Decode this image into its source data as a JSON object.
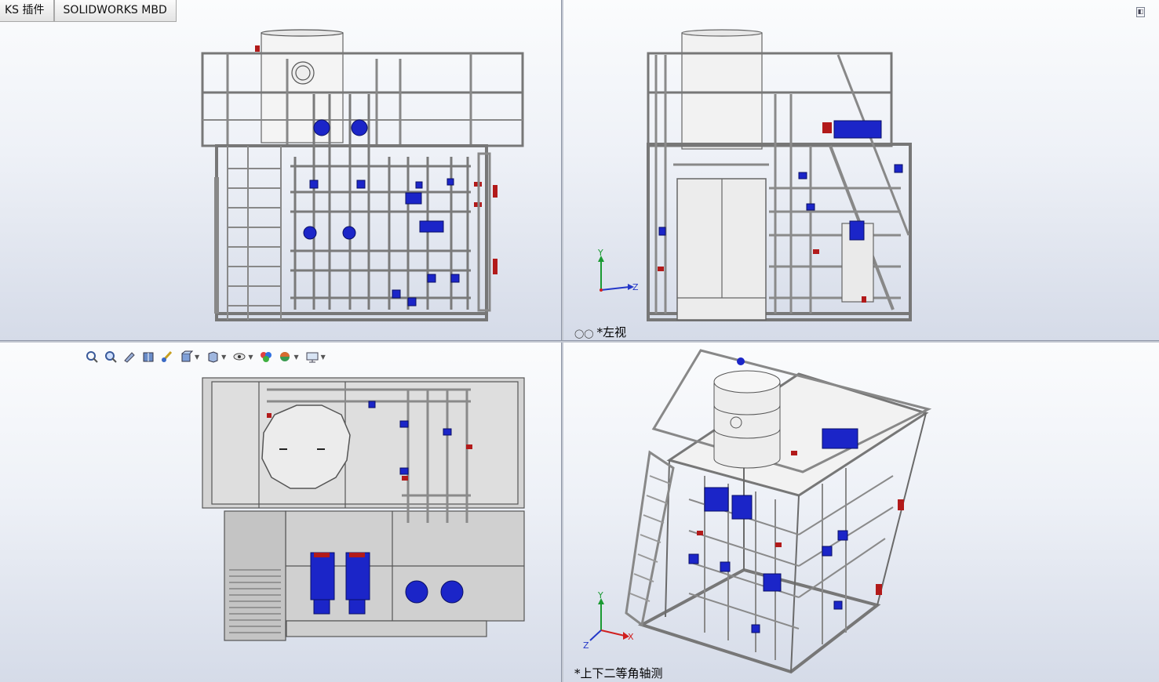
{
  "tabs": [
    {
      "label": "KS 插件"
    },
    {
      "label": "SOLIDWORKS MBD"
    }
  ],
  "viewports": {
    "left_view_label": "*左视",
    "iso_view_label": "*上下二等角轴测"
  },
  "triad": {
    "x": "X",
    "y": "Y",
    "z": "Z"
  },
  "hud_icons": [
    "zoom-to-fit-icon",
    "zoom-to-area-icon",
    "previous-view-icon",
    "section-view-icon",
    "dynamic-annotation-icon",
    "view-orientation-icon",
    "display-style-icon",
    "hide-show-items-icon",
    "edit-appearance-icon",
    "apply-scene-icon",
    "view-settings-icon"
  ],
  "colors": {
    "viewport_bg_top": "#fbfcfd",
    "viewport_bg_bottom": "#d5dbe8",
    "frame": "#9aa0aa",
    "pump_blue": "#1b25c8",
    "valve_red": "#b21a1a",
    "triad_y": "#1a9a32",
    "triad_z": "#2438c8",
    "triad_x": "#d02020"
  }
}
